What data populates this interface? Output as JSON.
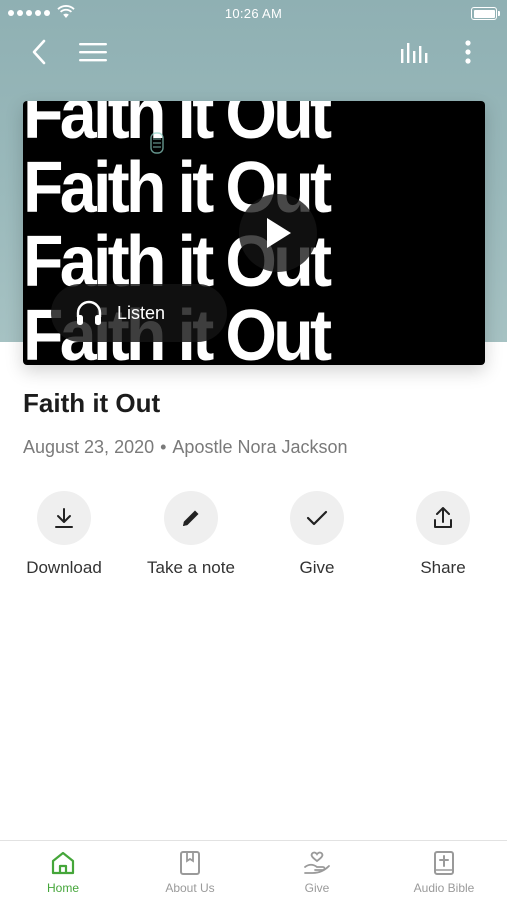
{
  "status_bar": {
    "time": "10:26 AM"
  },
  "media": {
    "art_text": [
      "Faith it Out",
      "Faith it Out",
      "Faith it Out",
      "Faith it Out"
    ],
    "listen_label": "Listen"
  },
  "sermon": {
    "title": "Faith it Out",
    "date": "August 23, 2020",
    "separator": "•",
    "speaker": "Apostle Nora Jackson"
  },
  "actions": [
    {
      "label": "Download",
      "icon": "download-icon"
    },
    {
      "label": "Take a note",
      "icon": "pencil-icon"
    },
    {
      "label": "Give",
      "icon": "check-icon"
    },
    {
      "label": "Share",
      "icon": "share-icon"
    }
  ],
  "tabs": [
    {
      "label": "Home",
      "icon": "home-icon",
      "active": true
    },
    {
      "label": "About Us",
      "icon": "book-icon",
      "active": false
    },
    {
      "label": "Give",
      "icon": "give-hand-icon",
      "active": false
    },
    {
      "label": "Audio Bible",
      "icon": "bible-icon",
      "active": false
    }
  ],
  "colors": {
    "hero_background": "#9ab9bb",
    "active_tab": "#45a63a",
    "inactive_tab": "#9a9a9a",
    "action_circle": "#efefef"
  }
}
